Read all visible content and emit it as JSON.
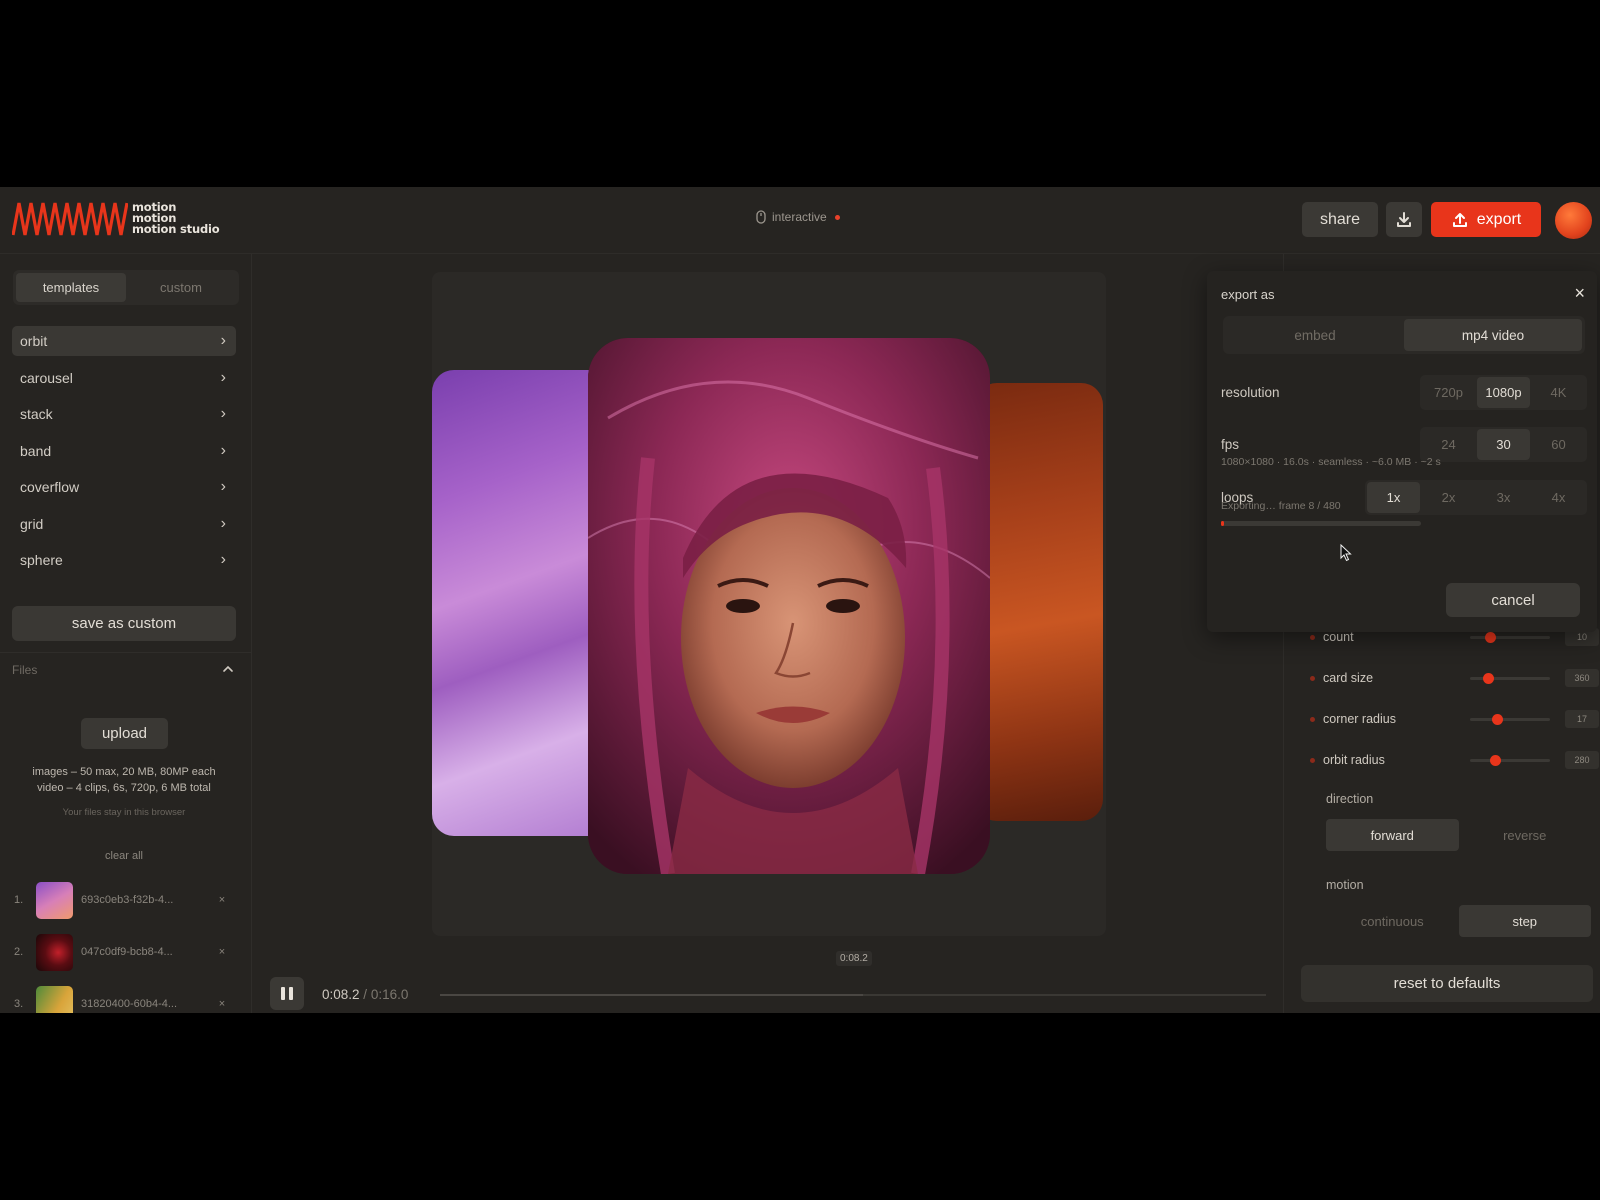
{
  "header": {
    "logo_lines": [
      "motion",
      "motion",
      "motion studio"
    ],
    "mode": "interactive",
    "share_label": "share",
    "export_label": "export",
    "download_icon": "download-icon",
    "export_icon": "upload-icon"
  },
  "colors": {
    "accent": "#e8351b",
    "background": "#262421",
    "panel": "#3a3834",
    "text": "#d9d4cc"
  },
  "sidebar": {
    "tabs": [
      {
        "label": "templates",
        "active": true
      },
      {
        "label": "custom",
        "active": false
      }
    ],
    "templates": [
      {
        "label": "orbit",
        "active": true
      },
      {
        "label": "carousel",
        "active": false
      },
      {
        "label": "stack",
        "active": false
      },
      {
        "label": "band",
        "active": false
      },
      {
        "label": "coverflow",
        "active": false
      },
      {
        "label": "grid",
        "active": false
      },
      {
        "label": "sphere",
        "active": false
      }
    ],
    "save_custom_label": "save as custom",
    "files_title": "Files",
    "upload_label": "upload",
    "limits_line1": "images – 50 max, 20 MB, 80MP each",
    "limits_line2": "video – 4 clips, 6s, 720p, 6 MB total",
    "privacy_note": "Your files stay in this browser",
    "clear_all_label": "clear all",
    "files": [
      {
        "index": "1.",
        "name": "693c0eb3-f32b-4...",
        "remove": "×"
      },
      {
        "index": "2.",
        "name": "047c0df9-bcb8-4...",
        "remove": "×"
      },
      {
        "index": "3.",
        "name": "31820400-60b4-4...",
        "remove": "×"
      }
    ]
  },
  "export_popover": {
    "title": "export as",
    "close_icon": "close-icon",
    "formats": [
      {
        "label": "embed",
        "active": false
      },
      {
        "label": "mp4 video",
        "active": true
      }
    ],
    "resolution": {
      "label": "resolution",
      "options": [
        {
          "label": "720p",
          "active": false
        },
        {
          "label": "1080p",
          "active": true
        },
        {
          "label": "4K",
          "active": false
        }
      ]
    },
    "fps": {
      "label": "fps",
      "options": [
        {
          "label": "24",
          "active": false
        },
        {
          "label": "30",
          "active": true
        },
        {
          "label": "60",
          "active": false
        }
      ]
    },
    "loops": {
      "label": "loops",
      "options": [
        {
          "label": "1x",
          "active": true
        },
        {
          "label": "2x",
          "active": false
        },
        {
          "label": "3x",
          "active": false
        },
        {
          "label": "4x",
          "active": false
        }
      ]
    },
    "summary": "1080×1080 · 16.0s · seamless · ~6.0 MB · ~2 s",
    "progress_text": "Exporting… frame 8 / 480",
    "progress_fraction": 0.0167,
    "cancel_label": "cancel"
  },
  "params": [
    {
      "label": "count",
      "value": "10",
      "level": 0.25
    },
    {
      "label": "card size",
      "value": "360",
      "level": 0.22
    },
    {
      "label": "corner radius",
      "value": "17",
      "level": 0.34
    },
    {
      "label": "orbit radius",
      "value": "280",
      "level": 0.31
    }
  ],
  "direction": {
    "label": "direction",
    "options": [
      {
        "label": "forward",
        "active": true
      },
      {
        "label": "reverse",
        "active": false
      }
    ]
  },
  "motion": {
    "label": "motion",
    "options": [
      {
        "label": "continuous",
        "active": false
      },
      {
        "label": "step",
        "active": true
      }
    ]
  },
  "reset_label": "reset to defaults",
  "playback": {
    "current": "0:08.2",
    "total": "0:16.0",
    "chip": "0:08.2",
    "progress": 0.5125
  }
}
